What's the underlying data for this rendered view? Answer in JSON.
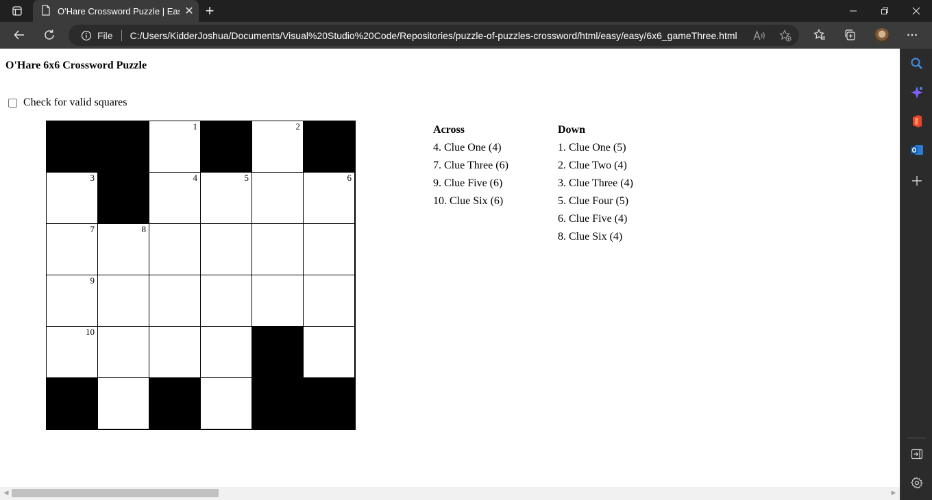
{
  "browser": {
    "tab_title": "O'Hare Crossword Puzzle | Easy",
    "address_scheme": "File",
    "url": "C:/Users/KidderJoshua/Documents/Visual%20Studio%20Code/Repositories/puzzle-of-puzzles-crossword/html/easy/easy/6x6_gameThree.html",
    "accent_color": "#3b3b3b"
  },
  "page": {
    "title": "O'Hare 6x6 Crossword Puzzle",
    "check_label": "Check for valid squares",
    "check_checked": false
  },
  "grid": {
    "size": 6,
    "cells": [
      [
        "#",
        "#",
        "1",
        "#",
        "2",
        "#"
      ],
      [
        "3",
        "#",
        "4",
        "5",
        "",
        "6"
      ],
      [
        "7",
        "8",
        "",
        "",
        "",
        ""
      ],
      [
        "9",
        "",
        "",
        "",
        "",
        ""
      ],
      [
        "10",
        "",
        "",
        "",
        "#",
        ""
      ],
      [
        "#",
        "",
        "#",
        "",
        "#",
        "#"
      ]
    ]
  },
  "clues": {
    "across_heading": "Across",
    "across": [
      "4. Clue One (4)",
      "7. Clue Three (6)",
      "9. Clue Five (6)",
      "10. Clue Six (6)"
    ],
    "down_heading": "Down",
    "down": [
      "1. Clue One (5)",
      "2. Clue Two (4)",
      "3. Clue Three (4)",
      "5. Clue Four (5)",
      "6. Clue Five (4)",
      "8. Clue Six (4)"
    ]
  }
}
